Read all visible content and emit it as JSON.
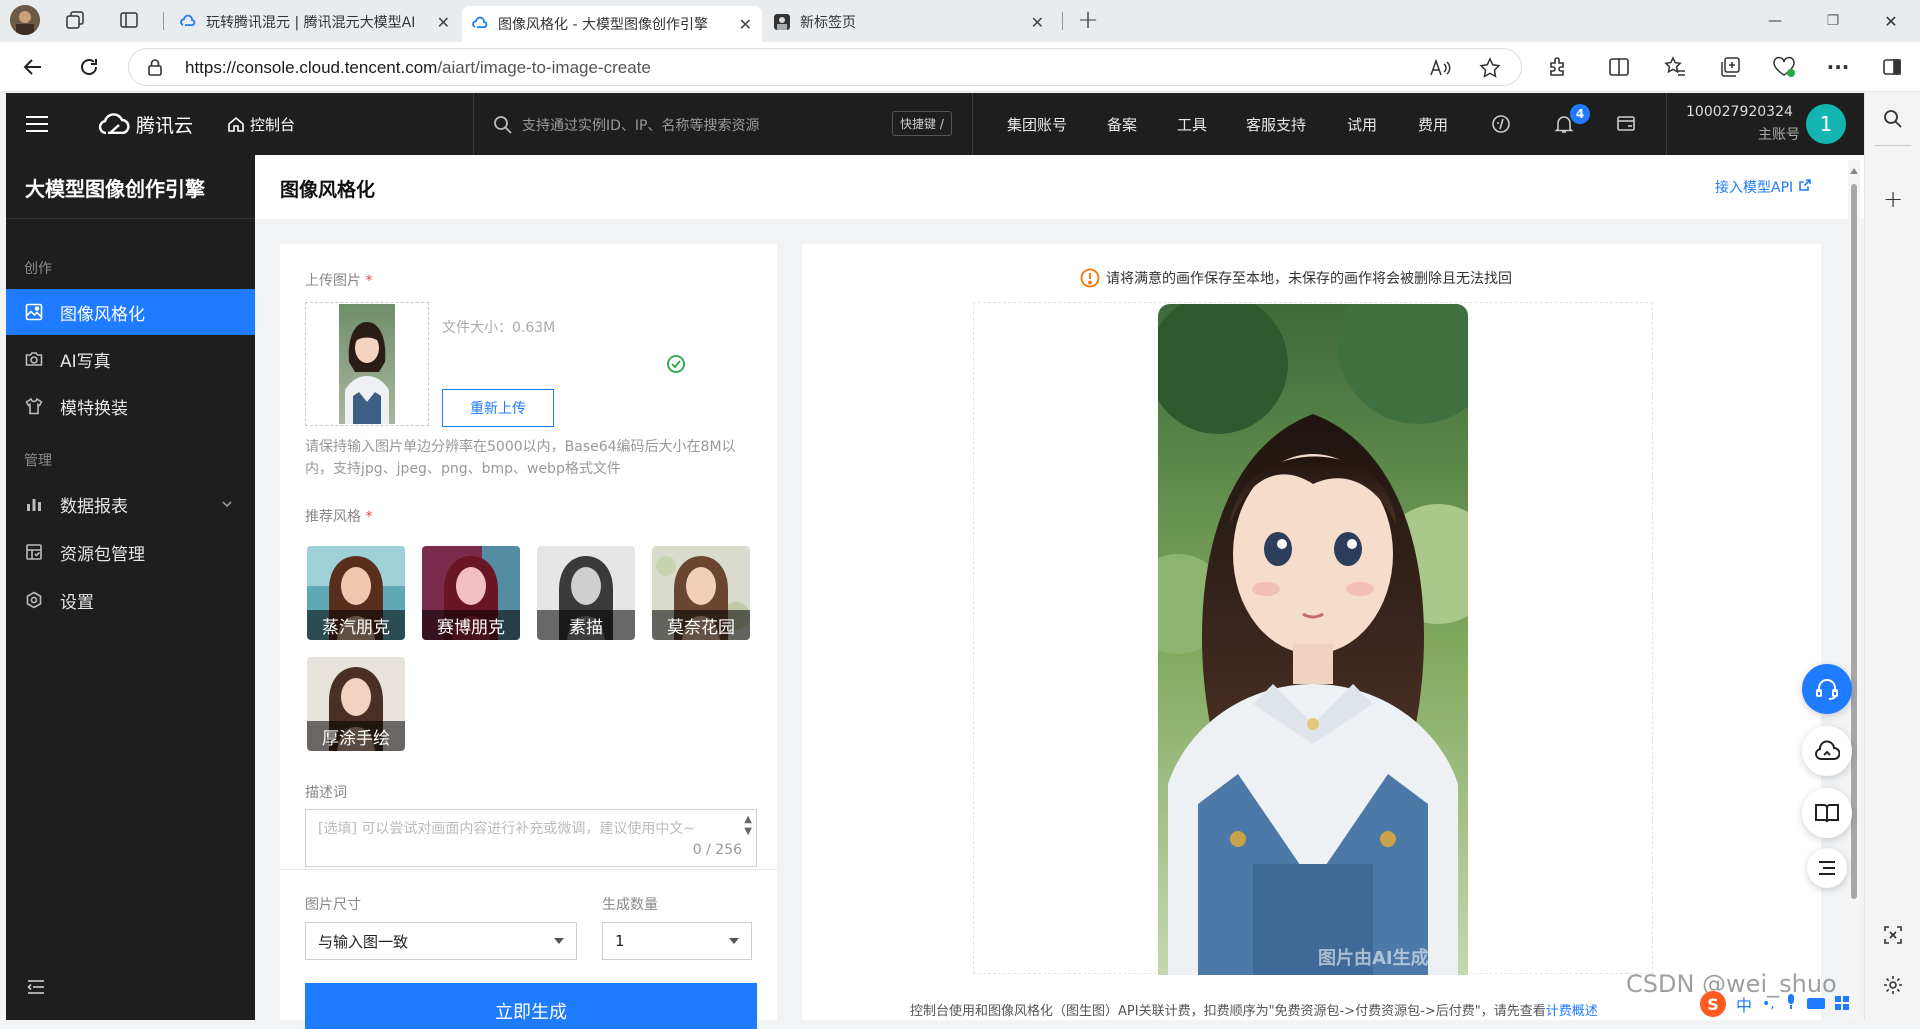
{
  "browser": {
    "tabs": [
      {
        "title": "玩转腾讯混元 | 腾讯混元大模型AI",
        "close": "✕"
      },
      {
        "title": "图像风格化 - 大模型图像创作引擎",
        "close": "✕"
      },
      {
        "title": "新标签页",
        "close": "✕"
      }
    ],
    "new_tab": "+",
    "url_prefix": "https://console.cloud.tencent.com",
    "url_path": "/aiart/image-to-image-create",
    "window_controls": {
      "minimize": "—",
      "restore": "❐",
      "close": "✕"
    }
  },
  "header": {
    "brand": "腾讯云",
    "console": "控制台",
    "search_placeholder": "支持通过实例ID、IP、名称等搜索资源",
    "shortcut": "快捷键 /",
    "nav": [
      "集团账号",
      "备案",
      "工具",
      "客服支持",
      "试用",
      "费用"
    ],
    "notify_count": "4",
    "account_id": "100027920324",
    "account_type": "主账号",
    "avatar": "1"
  },
  "sidebar": {
    "title": "大模型图像创作引擎",
    "group_create": "创作",
    "items_create": [
      {
        "label": "图像风格化",
        "icon": "image-icon"
      },
      {
        "label": "AI写真",
        "icon": "camera-icon"
      },
      {
        "label": "模特换装",
        "icon": "shirt-icon"
      }
    ],
    "group_manage": "管理",
    "items_manage": [
      {
        "label": "数据报表",
        "icon": "chart-icon"
      },
      {
        "label": "资源包管理",
        "icon": "package-icon"
      },
      {
        "label": "设置",
        "icon": "settings-icon"
      }
    ]
  },
  "page": {
    "title": "图像风格化",
    "api_link": "接入模型API"
  },
  "form": {
    "upload_label": "上传图片",
    "required_mark": "*",
    "file_size": "文件大小：0.63M",
    "reupload": "重新上传",
    "upload_hint": "请保持输入图片单边分辨率在5000以内，Base64编码后大小在8M以内，支持jpg、jpeg、png、bmp、webp格式文件",
    "style_label": "推荐风格",
    "styles": [
      "蒸汽朋克",
      "赛博朋克",
      "素描",
      "莫奈花园",
      "厚涂手绘"
    ],
    "prompt_label": "描述词",
    "prompt_placeholder": "[选填] 可以尝试对画面内容进行补充或微调，建议使用中文~",
    "prompt_count": "0 / 256",
    "size_label": "图片尺寸",
    "size_value": "与输入图一致",
    "count_label": "生成数量",
    "count_value": "1",
    "generate": "立即生成"
  },
  "result": {
    "warning": "请将满意的画作保存至本地，未保存的画作将会被删除且无法找回",
    "watermark": "图片由AI生成",
    "billing_text": "控制台使用和图像风格化（图生图）API关联计费，扣费顺序为\"免费资源包->付费资源包->后付费\"，请先查看",
    "billing_link": "计费概述"
  },
  "overlay": {
    "csdn": "CSDN @wei_shuo",
    "ime": "中"
  },
  "colors": {
    "accent": "#1f7bff",
    "header_bg": "#1e1e1e",
    "warning": "#ff7200",
    "success": "#22a848",
    "avatar": "#13b5b1",
    "badge": "#1f7bff"
  }
}
